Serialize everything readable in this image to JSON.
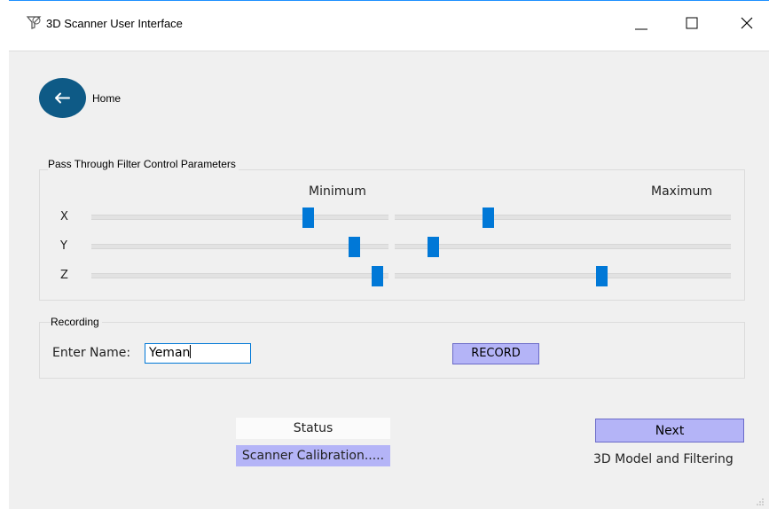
{
  "window": {
    "title": "3D Scanner User Interface",
    "controls": [
      "minimize",
      "maximize",
      "close"
    ]
  },
  "nav": {
    "home_label": "Home"
  },
  "filter": {
    "group_title": "Pass Through Filter Control Parameters",
    "min_header": "Minimum",
    "max_header": "Maximum",
    "axes": [
      {
        "label": "X",
        "min_level": 0.74,
        "max_level": 0.27
      },
      {
        "label": "Y",
        "min_level": 0.9,
        "max_level": 0.1
      },
      {
        "label": "Z",
        "min_level": 0.98,
        "max_level": 0.62
      }
    ]
  },
  "recording": {
    "group_title": "Recording",
    "name_label": "Enter Name:",
    "name_value": "Yeman",
    "record_button": "RECORD"
  },
  "status": {
    "header": "Status",
    "value": "Scanner Calibration....."
  },
  "next": {
    "button": "Next",
    "caption": "3D Model and Filtering"
  },
  "colors": {
    "accent": "#0078d7",
    "home_button": "#0e5a86",
    "button_fill": "#b4b4f7"
  }
}
